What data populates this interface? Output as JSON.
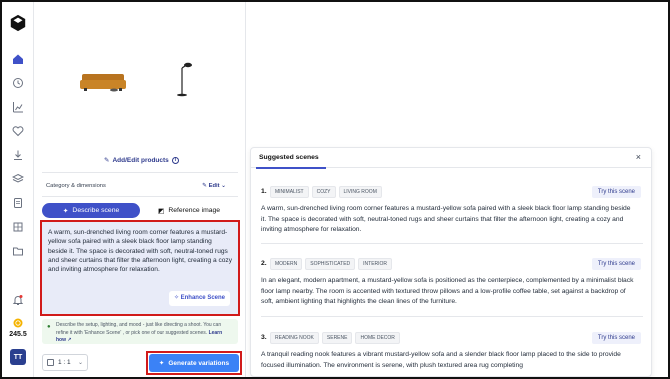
{
  "rail": {
    "credits": "245.5",
    "avatar_initials": "TT"
  },
  "panel": {
    "add_edit_label": "Add/Edit products",
    "category_label": "Category & dimensions",
    "edit_label": "Edit",
    "tab_describe": "Describe scene",
    "tab_reference": "Reference image",
    "description": "A warm, sun-drenched living room corner features a mustard-yellow sofa paired with a sleek black floor lamp standing beside it. The space is decorated with soft, neutral-toned rugs and sheer curtains that filter the afternoon light, creating a cozy and inviting atmosphere for relaxation.",
    "enhance_label": "Enhance Scene",
    "tip_text": "Describe the setup, lighting, and mood - just like directing a shoot. You can refine it with 'Enhance Scene' , or pick one of our suggested scenes.",
    "tip_link": "Learn how",
    "ratio_value": "1 : 1",
    "generate_label": "Generate variations"
  },
  "modal": {
    "title": "Suggested scenes",
    "try_label": "Try this scene",
    "scenes": [
      {
        "num": "1.",
        "tags": [
          "MINIMALIST",
          "COZY",
          "LIVING ROOM"
        ],
        "text": "A warm, sun-drenched living room corner features a mustard-yellow sofa paired with a sleek black floor lamp standing beside it. The space is decorated with soft, neutral-toned rugs and sheer curtains that filter the afternoon light, creating a cozy and inviting atmosphere for relaxation."
      },
      {
        "num": "2.",
        "tags": [
          "MODERN",
          "SOPHISTICATED",
          "INTERIOR"
        ],
        "text": "In an elegant, modern apartment, a mustard-yellow sofa is positioned as the centerpiece, complemented by a minimalist black floor lamp nearby. The room is accented with textured throw pillows and a low-profile coffee table, set against a backdrop of soft, ambient lighting that highlights the clean lines of the furniture."
      },
      {
        "num": "3.",
        "tags": [
          "READING NOOK",
          "SERENE",
          "HOME DECOR"
        ],
        "text": "A tranquil reading nook features a vibrant mustard-yellow sofa and a slender black floor lamp placed to the side to provide focused illumination. The environment is serene, with plush textured area rug completing"
      }
    ]
  },
  "colors": {
    "accent": "#3f51c8",
    "highlight_border": "#d11a1a",
    "generate_button": "#3b82f6"
  }
}
